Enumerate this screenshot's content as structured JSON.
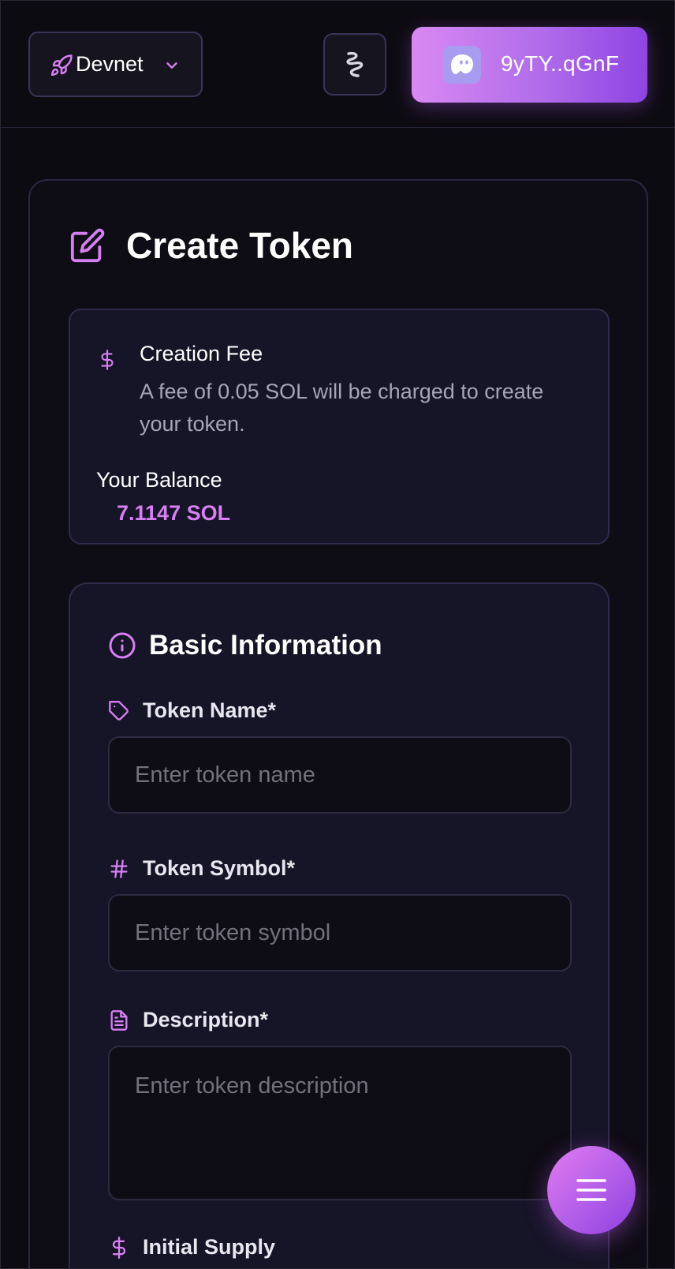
{
  "header": {
    "network_label": "Devnet",
    "wallet_address": "9yTY..qGnF"
  },
  "main": {
    "title": "Create Token",
    "fee": {
      "title": "Creation Fee",
      "description": "A fee of 0.05 SOL will be charged to create your token.",
      "balance_label": "Your Balance",
      "balance_value": "7.1147 SOL"
    },
    "basic_info": {
      "title": "Basic Information",
      "fields": {
        "name": {
          "label": "Token Name*",
          "placeholder": "Enter token name",
          "value": ""
        },
        "symbol": {
          "label": "Token Symbol*",
          "placeholder": "Enter token symbol",
          "value": ""
        },
        "description": {
          "label": "Description*",
          "placeholder": "Enter token description",
          "value": ""
        },
        "supply": {
          "label": "Initial Supply"
        }
      }
    }
  },
  "colors": {
    "accent": "#d77ff2",
    "background": "#0d0b12",
    "panel": "#161427",
    "border": "#2f2b4a"
  },
  "icons": {
    "network": "rocket-icon",
    "theme": "swirl-icon",
    "wallet": "ghost-icon",
    "title": "edit-icon",
    "fee": "dollar-icon",
    "section": "info-icon",
    "name": "tag-icon",
    "symbol": "hash-icon",
    "description": "file-text-icon",
    "supply": "dollar-icon",
    "menu": "menu-icon"
  }
}
